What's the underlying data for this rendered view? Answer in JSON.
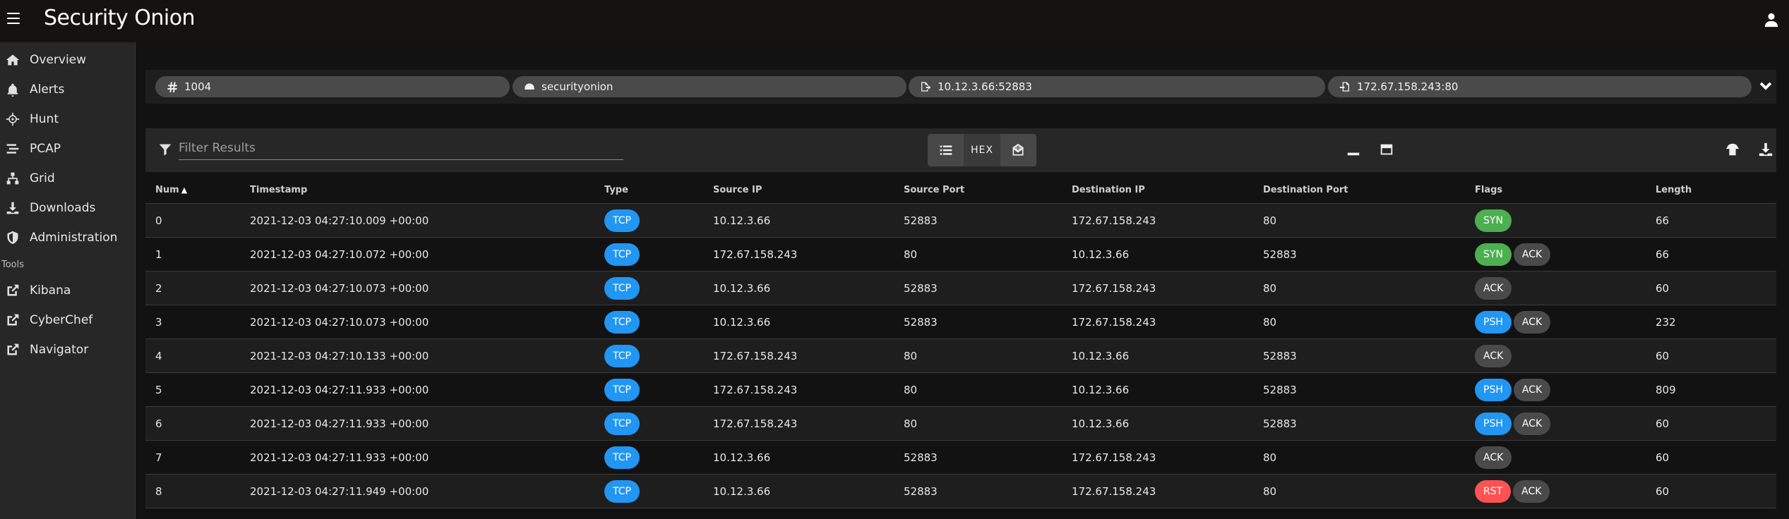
{
  "app": {
    "title": "Security Onion"
  },
  "sidebar": {
    "items": [
      {
        "label": "Overview",
        "icon": "home-icon"
      },
      {
        "label": "Alerts",
        "icon": "bell-icon"
      },
      {
        "label": "Hunt",
        "icon": "crosshairs-icon"
      },
      {
        "label": "PCAP",
        "icon": "stream-icon"
      },
      {
        "label": "Grid",
        "icon": "sitemap-icon"
      },
      {
        "label": "Downloads",
        "icon": "download-icon"
      },
      {
        "label": "Administration",
        "icon": "shield-icon"
      }
    ],
    "tools_title": "Tools",
    "tools": [
      {
        "label": "Kibana",
        "icon": "external-link-icon"
      },
      {
        "label": "CyberChef",
        "icon": "external-link-icon"
      },
      {
        "label": "Navigator",
        "icon": "external-link-icon"
      }
    ]
  },
  "chips": {
    "id": "1004",
    "sensor": "securityonion",
    "source": "10.12.3.66:52883",
    "destination": "172.67.158.243:80"
  },
  "toolbar": {
    "filter_placeholder": "Filter Results",
    "hex_label": "HEX"
  },
  "table": {
    "headers": {
      "num": "Num",
      "timestamp": "Timestamp",
      "type": "Type",
      "source_ip": "Source IP",
      "source_port": "Source Port",
      "destination_ip": "Destination IP",
      "destination_port": "Destination Port",
      "flags": "Flags",
      "length": "Length"
    },
    "rows": [
      {
        "num": "0",
        "timestamp": "2021-12-03 04:27:10.009 +00:00",
        "type": "TCP",
        "src_ip": "10.12.3.66",
        "src_port": "52883",
        "dst_ip": "172.67.158.243",
        "dst_port": "80",
        "flags": [
          "SYN"
        ],
        "length": "66"
      },
      {
        "num": "1",
        "timestamp": "2021-12-03 04:27:10.072 +00:00",
        "type": "TCP",
        "src_ip": "172.67.158.243",
        "src_port": "80",
        "dst_ip": "10.12.3.66",
        "dst_port": "52883",
        "flags": [
          "SYN",
          "ACK"
        ],
        "length": "66"
      },
      {
        "num": "2",
        "timestamp": "2021-12-03 04:27:10.073 +00:00",
        "type": "TCP",
        "src_ip": "10.12.3.66",
        "src_port": "52883",
        "dst_ip": "172.67.158.243",
        "dst_port": "80",
        "flags": [
          "ACK"
        ],
        "length": "60"
      },
      {
        "num": "3",
        "timestamp": "2021-12-03 04:27:10.073 +00:00",
        "type": "TCP",
        "src_ip": "10.12.3.66",
        "src_port": "52883",
        "dst_ip": "172.67.158.243",
        "dst_port": "80",
        "flags": [
          "PSH",
          "ACK"
        ],
        "length": "232"
      },
      {
        "num": "4",
        "timestamp": "2021-12-03 04:27:10.133 +00:00",
        "type": "TCP",
        "src_ip": "172.67.158.243",
        "src_port": "80",
        "dst_ip": "10.12.3.66",
        "dst_port": "52883",
        "flags": [
          "ACK"
        ],
        "length": "60"
      },
      {
        "num": "5",
        "timestamp": "2021-12-03 04:27:11.933 +00:00",
        "type": "TCP",
        "src_ip": "172.67.158.243",
        "src_port": "80",
        "dst_ip": "10.12.3.66",
        "dst_port": "52883",
        "flags": [
          "PSH",
          "ACK"
        ],
        "length": "809"
      },
      {
        "num": "6",
        "timestamp": "2021-12-03 04:27:11.933 +00:00",
        "type": "TCP",
        "src_ip": "172.67.158.243",
        "src_port": "80",
        "dst_ip": "10.12.3.66",
        "dst_port": "52883",
        "flags": [
          "PSH",
          "ACK"
        ],
        "length": "60"
      },
      {
        "num": "7",
        "timestamp": "2021-12-03 04:27:11.933 +00:00",
        "type": "TCP",
        "src_ip": "10.12.3.66",
        "src_port": "52883",
        "dst_ip": "172.67.158.243",
        "dst_port": "80",
        "flags": [
          "ACK"
        ],
        "length": "60"
      },
      {
        "num": "8",
        "timestamp": "2021-12-03 04:27:11.949 +00:00",
        "type": "TCP",
        "src_ip": "10.12.3.66",
        "src_port": "52883",
        "dst_ip": "172.67.158.243",
        "dst_port": "80",
        "flags": [
          "RST",
          "ACK"
        ],
        "length": "60"
      }
    ]
  },
  "colors": {
    "tcp": "#2196f3",
    "SYN": "#4caf50",
    "ACK": "#4a4a4a",
    "PSH": "#2196f3",
    "RST": "#ff5252"
  }
}
